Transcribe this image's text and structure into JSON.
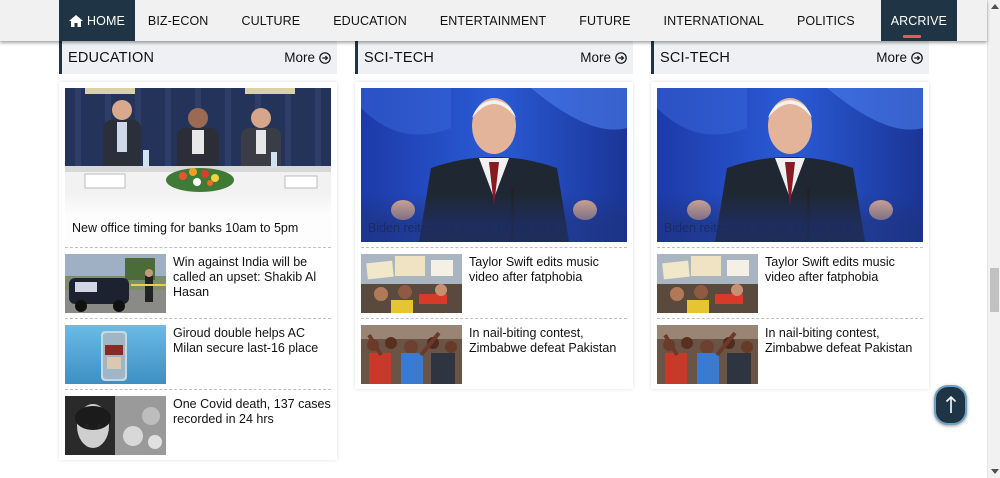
{
  "nav": {
    "home": "HOME",
    "items": [
      "BIZ-ECON",
      "CULTURE",
      "EDUCATION",
      "ENTERTAINMENT",
      "FUTURE",
      "INTERNATIONAL",
      "POLITICS"
    ],
    "active": "ARCRIVE"
  },
  "columns": [
    {
      "title": "EDUCATION",
      "more": "More",
      "lead_caption": "New office timing for banks 10am to 5pm",
      "items": [
        "Win against India will be called an upset: Shakib Al Hasan",
        "Giroud double helps AC Milan secure last-16 place",
        "One Covid death, 137 cases recorded in 24 hrs"
      ]
    },
    {
      "title": "SCI-TECH",
      "more": "More",
      "lead_caption": "Biden reiterates on the bill he said",
      "items": [
        "Taylor Swift edits music video after fatphobia",
        "In nail-biting contest, Zimbabwe defeat Pakistan"
      ]
    },
    {
      "title": "SCI-TECH",
      "more": "More",
      "lead_caption": "Biden reiterates on the bill he said",
      "items": [
        "Taylor Swift edits music video after fatphobia",
        "In nail-biting contest, Zimbabwe defeat Pakistan"
      ]
    }
  ],
  "colors": {
    "nav_active_bg": "#1f3545",
    "nav_bg": "#f1f1f1",
    "header_bg": "#eef0f3",
    "accent_underline": "#e85a5a"
  },
  "icons": {
    "home": "home-icon",
    "more": "circle-arrow-right-icon",
    "to_top": "arrow-up-icon"
  }
}
